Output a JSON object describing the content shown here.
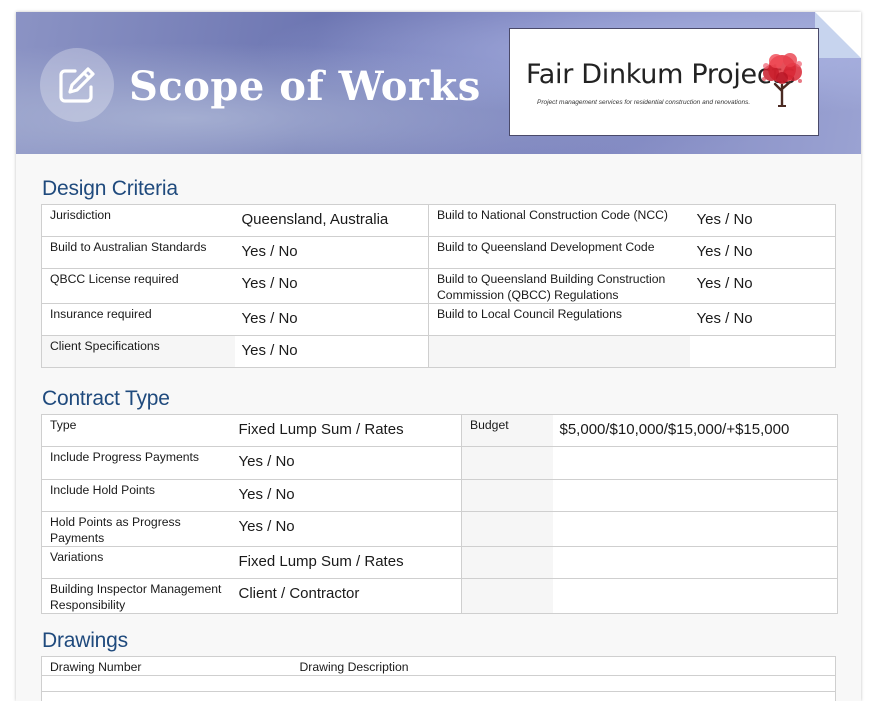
{
  "header": {
    "title": "Scope of Works",
    "logo": {
      "name": "Fair Dinkum Projects",
      "tagline": "Project management services for residential construction and renovations."
    }
  },
  "design_criteria": {
    "title": "Design Criteria",
    "rows": [
      {
        "label1": "Jurisdiction",
        "value1": "Queensland, Australia",
        "label2": "Build to National Construction Code (NCC)",
        "value2": "Yes / No"
      },
      {
        "label1": "Build to Australian Standards",
        "value1": "Yes / No",
        "label2": "Build to Queensland Development Code",
        "value2": "Yes / No"
      },
      {
        "label1": "QBCC License required",
        "value1": "Yes / No",
        "label2": "Build to Queensland Building Construction Commission (QBCC) Regulations",
        "value2": "Yes / No"
      },
      {
        "label1": "Insurance required",
        "value1": "Yes / No",
        "label2": "Build to Local Council Regulations",
        "value2": "Yes / No"
      },
      {
        "label1": "Client Specifications",
        "value1": "Yes / No",
        "label2": "",
        "value2": ""
      }
    ]
  },
  "contract_type": {
    "title": "Contract Type",
    "rows": [
      {
        "label1": "Type",
        "value1": "Fixed Lump Sum / Rates",
        "label2": "Budget",
        "value2": "$5,000/$10,000/$15,000/+$15,000"
      },
      {
        "label1": "Include Progress Payments",
        "value1": "Yes / No",
        "label2": "",
        "value2": ""
      },
      {
        "label1": "Include Hold Points",
        "value1": "Yes / No",
        "label2": "",
        "value2": ""
      },
      {
        "label1": "Hold Points as Progress Payments",
        "value1": "Yes / No",
        "label2": "",
        "value2": ""
      },
      {
        "label1": "Variations",
        "value1": "Fixed Lump Sum / Rates",
        "label2": "",
        "value2": ""
      },
      {
        "label1": "Building Inspector Management Responsibility",
        "value1": "Client / Contractor",
        "label2": "",
        "value2": ""
      }
    ]
  },
  "drawings": {
    "title": "Drawings",
    "columns": [
      "Drawing Number",
      "Drawing Description"
    ]
  },
  "colors": {
    "section_title": "#1f4a7d",
    "banner": "#7a82bd",
    "logo_tree": "#d81e2c"
  },
  "icons": {
    "header_badge": "edit-icon",
    "logo_mark": "tree-of-hearts-icon"
  }
}
